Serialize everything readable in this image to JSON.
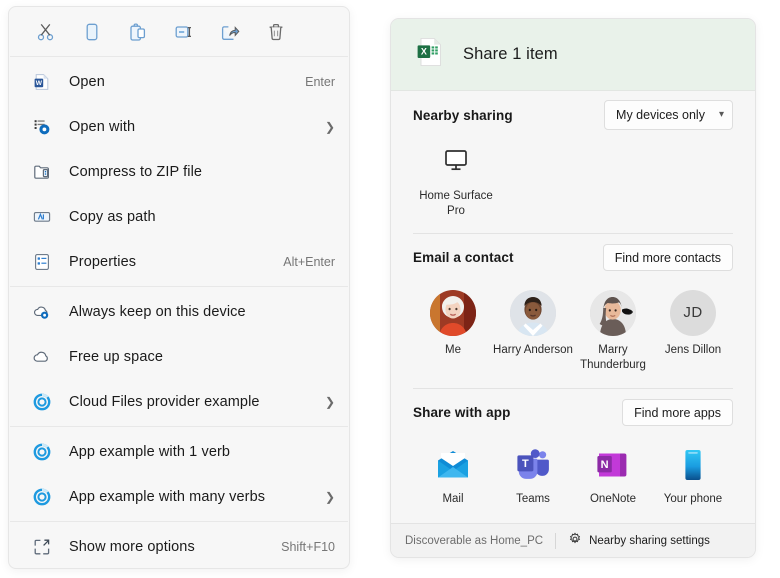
{
  "context_menu": {
    "toolbar": [
      {
        "name": "cut-icon",
        "label": "Cut"
      },
      {
        "name": "copy-icon",
        "label": "Copy"
      },
      {
        "name": "paste-icon",
        "label": "Paste"
      },
      {
        "name": "rename-icon",
        "label": "Rename"
      },
      {
        "name": "share-icon",
        "label": "Share"
      },
      {
        "name": "delete-icon",
        "label": "Delete"
      }
    ],
    "groups": [
      {
        "items": [
          {
            "label": "Open",
            "accel": "Enter",
            "submenu": false,
            "icon": "word-document-icon"
          },
          {
            "label": "Open with",
            "accel": "",
            "submenu": true,
            "icon": "open-with-icon"
          },
          {
            "label": "Compress to ZIP file",
            "accel": "",
            "submenu": false,
            "icon": "zip-folder-icon"
          },
          {
            "label": "Copy as path",
            "accel": "",
            "submenu": false,
            "icon": "copy-as-path-icon"
          },
          {
            "label": "Properties",
            "accel": "Alt+Enter",
            "submenu": false,
            "icon": "properties-icon"
          }
        ]
      },
      {
        "items": [
          {
            "label": "Always keep on this device",
            "accel": "",
            "submenu": false,
            "icon": "cloud-pin-icon"
          },
          {
            "label": "Free up space",
            "accel": "",
            "submenu": false,
            "icon": "cloud-icon"
          },
          {
            "label": "Cloud Files provider example",
            "accel": "",
            "submenu": true,
            "icon": "cloud-provider-icon"
          }
        ]
      },
      {
        "items": [
          {
            "label": "App example with 1 verb",
            "accel": "",
            "submenu": false,
            "icon": "cloud-provider-icon"
          },
          {
            "label": "App example with many verbs",
            "accel": "",
            "submenu": true,
            "icon": "cloud-provider-icon"
          }
        ]
      },
      {
        "items": [
          {
            "label": "Show more options",
            "accel": "Shift+F10",
            "submenu": false,
            "icon": "show-more-options-icon"
          }
        ]
      }
    ]
  },
  "share_panel": {
    "header": {
      "title": "Share 1 item",
      "file_icon": "excel-file-icon"
    },
    "nearby": {
      "title": "Nearby sharing",
      "dropdown_value": "My devices only",
      "devices": [
        {
          "name": "Home Surface Pro",
          "icon": "monitor-icon"
        }
      ]
    },
    "email": {
      "title": "Email a contact",
      "button": "Find more contacts",
      "contacts": [
        {
          "name": "Me",
          "type": "photo",
          "initials": ""
        },
        {
          "name": "Harry Anderson",
          "type": "photo",
          "initials": ""
        },
        {
          "name": "Marry Thunderburg",
          "type": "photo",
          "initials": ""
        },
        {
          "name": "Jens Dillon",
          "type": "initials",
          "initials": "JD"
        }
      ]
    },
    "apps": {
      "title": "Share with app",
      "button": "Find more apps",
      "items": [
        {
          "name": "Mail",
          "icon": "mail-app-icon"
        },
        {
          "name": "Teams",
          "icon": "teams-app-icon"
        },
        {
          "name": "OneNote",
          "icon": "onenote-app-icon"
        },
        {
          "name": "Your phone",
          "icon": "your-phone-app-icon"
        }
      ]
    },
    "footer": {
      "discoverable": "Discoverable as Home_PC",
      "settings_link": "Nearby sharing settings",
      "settings_icon": "gear-icon"
    }
  },
  "colors": {
    "accent_blue": "#4a9de0",
    "excel_green": "#1d7044",
    "word_blue": "#2b579a",
    "menu_bg": "#f7f7f7",
    "share_header_bg": "#e9f2ea"
  }
}
